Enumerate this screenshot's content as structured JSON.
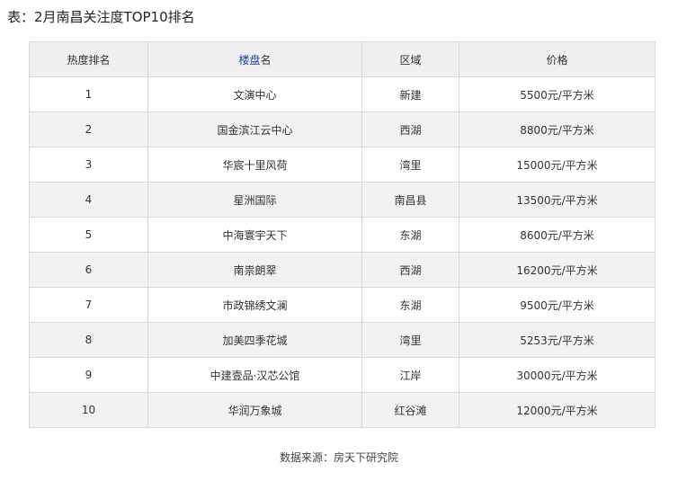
{
  "caption": "表：2月南昌关注度TOP10排名",
  "table": {
    "headers": {
      "rank": "热度排名",
      "name_link": "楼盘",
      "name_suffix": "名",
      "district": "区域",
      "price": "价格"
    },
    "rows": [
      {
        "rank": "1",
        "name": "文演中心",
        "district": "新建",
        "price": "5500元/平方米"
      },
      {
        "rank": "2",
        "name": "国金滨江云中心",
        "district": "西湖",
        "price": "8800元/平方米"
      },
      {
        "rank": "3",
        "name": "华宸十里风荷",
        "district": "湾里",
        "price": "15000元/平方米"
      },
      {
        "rank": "4",
        "name": "星洲国际",
        "district": "南昌县",
        "price": "13500元/平方米"
      },
      {
        "rank": "5",
        "name": "中海寰宇天下",
        "district": "东湖",
        "price": "8600元/平方米"
      },
      {
        "rank": "6",
        "name": "南祟朗翠",
        "district": "西湖",
        "price": "16200元/平方米"
      },
      {
        "rank": "7",
        "name": "市政锦绣文澜",
        "district": "东湖",
        "price": "9500元/平方米"
      },
      {
        "rank": "8",
        "name": "加美四季花城",
        "district": "湾里",
        "price": "5253元/平方米"
      },
      {
        "rank": "9",
        "name": "中建壹品·汉芯公馆",
        "district": "江岸",
        "price": "30000元/平方米"
      },
      {
        "rank": "10",
        "name": "华润万象城",
        "district": "红谷滩",
        "price": "12000元/平方米"
      }
    ]
  },
  "source": "数据来源：房天下研究院",
  "colors": {
    "header_bg": "#f0f0f0",
    "stripe_bg": "#f2f2f2",
    "border": "#d9d9d9",
    "link": "#1a3faa"
  }
}
